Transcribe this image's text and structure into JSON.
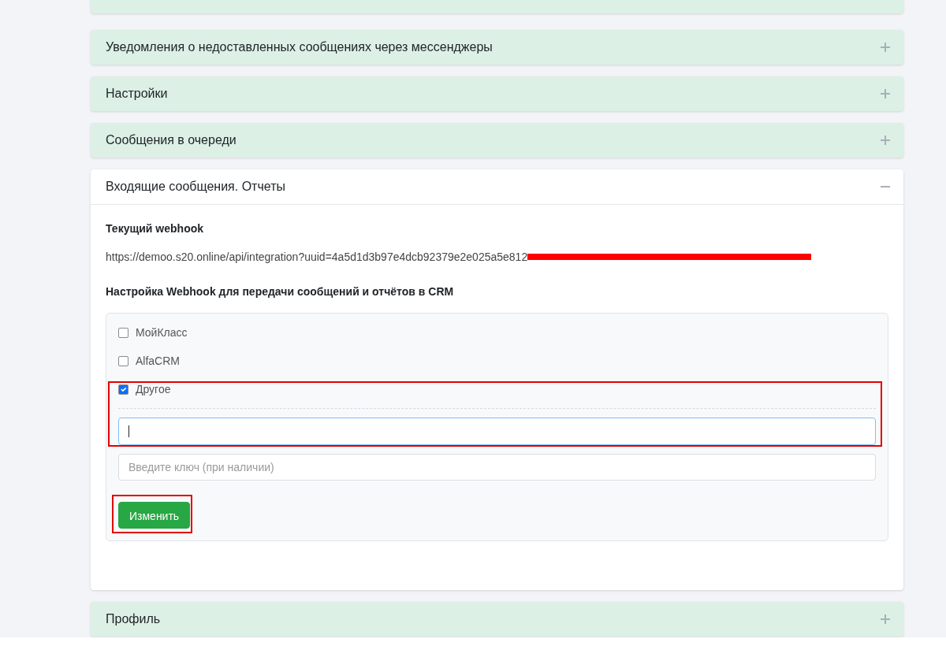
{
  "panels": [
    {
      "expanded": false
    },
    {
      "title": "Уведомления о недоставленных сообщениях через мессенджеры",
      "expanded": false
    },
    {
      "title": "Настройки",
      "expanded": false
    },
    {
      "title": "Сообщения в очереди",
      "expanded": false
    },
    {
      "title": "Входящие сообщения. Отчеты",
      "expanded": true,
      "content": {
        "current_label": "Текущий webhook",
        "current_url": "https://demoo.s20.online/api/integration?uuid=4a5d1d3b97e4dcb92379e2e025a5e812",
        "url_redacted": true,
        "settings_label": "Настройка Webhook для передачи сообщений и отчётов в CRM",
        "crm_options": [
          {
            "label": "МойКласс",
            "checked": false,
            "highlighted": false
          },
          {
            "label": "AlfaCRM",
            "checked": false,
            "highlighted": false
          },
          {
            "label": "Другое",
            "checked": true,
            "highlighted": true,
            "url_field": {
              "focused": true
            }
          }
        ],
        "key_field": {
          "placeholder": "Введите ключ (при наличии)"
        },
        "submit_button": {
          "label": "Изменить",
          "highlighted": true
        }
      }
    },
    {
      "title": "Профиль",
      "expanded": false
    }
  ]
}
